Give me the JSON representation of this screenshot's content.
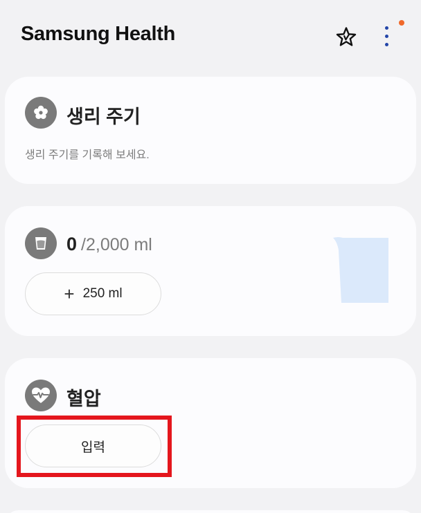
{
  "header": {
    "title": "Samsung Health",
    "favorites_icon": "star-icon",
    "more_icon": "more-vertical-icon",
    "notification_color": "#f0692a"
  },
  "cards": {
    "period": {
      "icon": "flower-icon",
      "title": "생리 주기",
      "description": "생리 주기를 기록해 보세요."
    },
    "water": {
      "icon": "cup-icon",
      "current": "0",
      "goal": "/2,000 ml",
      "add_label": "250 ml",
      "illustration": "water-glass-icon"
    },
    "blood_pressure": {
      "icon": "heart-pulse-icon",
      "title": "혈압",
      "input_label": "입력"
    }
  },
  "colors": {
    "accent_dots": "#2345a8",
    "highlight": "#e4161d",
    "icon_bg": "#7a7a7a",
    "water_fill": "#dbe9fb"
  }
}
